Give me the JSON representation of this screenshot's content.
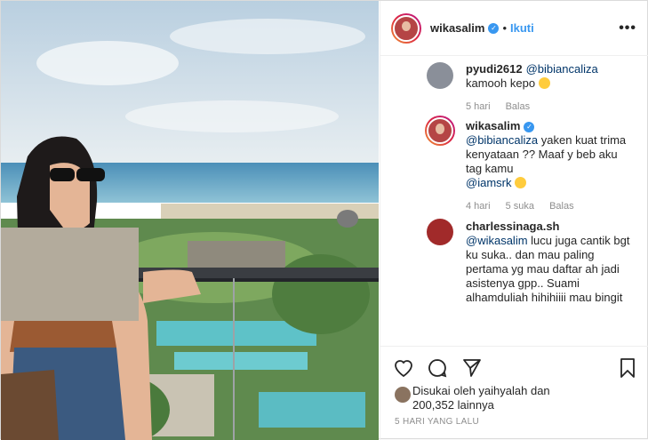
{
  "header": {
    "username": "wikasalim",
    "separator": "•",
    "follow_label": "Ikuti",
    "more_label": "•••"
  },
  "comments": [
    {
      "username": "pyudi2612",
      "mention": "@bibiancaliza",
      "text": "kamooh kepo",
      "time": "5 hari",
      "reply_label": "Balas",
      "avatar_color": "#8a8f99"
    },
    {
      "username": "wikasalim",
      "mention": "@bibiancaliza",
      "text": "yaken kuat trima kenyataan ?? Maaf y beb aku tag kamu",
      "mention2": "@iamsrk",
      "time": "4 hari",
      "likes": "5 suka",
      "reply_label": "Balas"
    },
    {
      "username": "charlessinaga.sh",
      "mention": "@wikasalim",
      "text": "lucu juga cantik bgt ku suka.. dan mau paling pertama yg mau daftar ah jadi asistenya gpp.. Suami alhamduliah hihihiiii mau bingit",
      "avatar_color": "#a12a2a"
    }
  ],
  "likes": {
    "line1": "Disukai oleh yaihyalah dan",
    "line2": "200,352 lainnya"
  },
  "date": "5 HARI YANG LALU",
  "icons": [
    "heart-icon",
    "comment-icon",
    "share-icon",
    "bookmark-icon",
    "verified-icon",
    "more-icon"
  ],
  "colors": {
    "link_blue": "#3897f0",
    "mention": "#003569",
    "muted": "#8e8e8e",
    "text": "#262626"
  }
}
